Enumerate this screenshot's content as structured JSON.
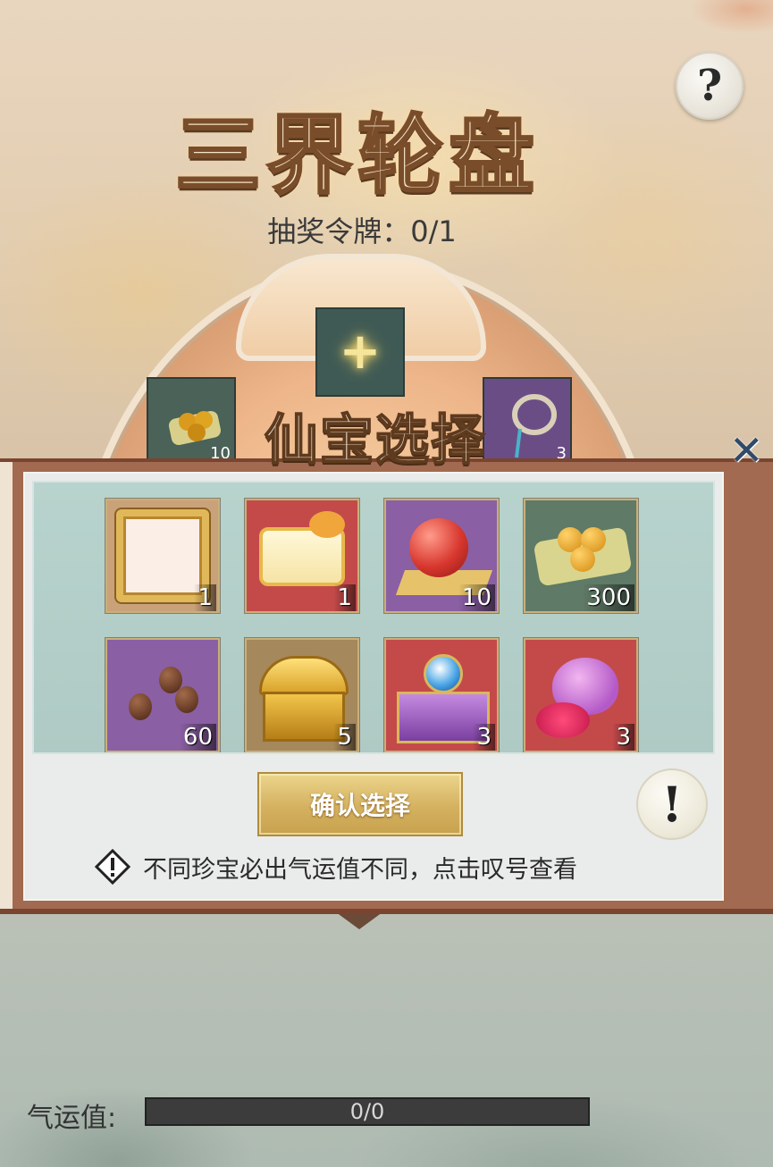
{
  "header": {
    "title": "三界轮盘",
    "token_label": "抽奖令牌：0/1",
    "help_icon": "question-icon"
  },
  "wheel": {
    "center_slot_icon": "plus-icon",
    "left_slot_count": "10",
    "right_slot_count": "3"
  },
  "popup": {
    "title": "仙宝选择",
    "close_icon": "close-icon",
    "items": [
      {
        "name": "avatar-frame-gold",
        "count": "1",
        "bg": "#c9a27a"
      },
      {
        "name": "dragon-chat-bubble",
        "count": "1",
        "bg": "#c44a4a"
      },
      {
        "name": "red-orb",
        "count": "10",
        "bg": "#8a5fa3"
      },
      {
        "name": "golden-fruits",
        "count": "300",
        "bg": "#5f7a66"
      },
      {
        "name": "brown-seeds",
        "count": "60",
        "bg": "#8a5fa3"
      },
      {
        "name": "golden-chest",
        "count": "5",
        "bg": "#a6885d"
      },
      {
        "name": "purple-chest",
        "count": "3",
        "bg": "#c44a4a"
      },
      {
        "name": "flower-pouch",
        "count": "3",
        "bg": "#c44a4a"
      }
    ],
    "confirm_label": "确认选择",
    "info_icon": "exclamation-icon",
    "hint_icon": "warning-icon",
    "hint_text": "不同珍宝必出气运值不同，点击叹号查看"
  },
  "luck": {
    "label": "气运值:",
    "progress_text": "0/0",
    "progress": 0
  }
}
